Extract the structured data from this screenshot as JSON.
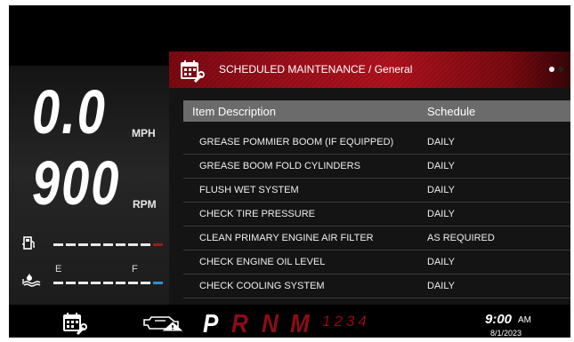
{
  "instrument": {
    "speed": "0.0",
    "speed_unit": "MPH",
    "rpm": "900",
    "rpm_unit": "RPM",
    "fuel_icon": "fuel-pump-icon",
    "temp_icon": "tank-level-icon",
    "empty_label": "E",
    "full_label": "F",
    "fuel_level_fraction": 0.9,
    "tank_level_fraction": 1.0
  },
  "maintenance": {
    "header_icon": "calendar-wrench-icon",
    "title": "SCHEDULED MAINTENANCE / General",
    "page_dots": {
      "total": 2,
      "active": 1
    },
    "columns": {
      "description": "Item Description",
      "schedule": "Schedule"
    },
    "rows": [
      {
        "description": "GREASE POMMIER BOOM (IF EQUIPPED)",
        "schedule": "DAILY"
      },
      {
        "description": "GREASE BOOM FOLD CYLINDERS",
        "schedule": "DAILY"
      },
      {
        "description": "FLUSH WET SYSTEM",
        "schedule": "DAILY"
      },
      {
        "description": "CHECK TIRE PRESSURE",
        "schedule": "DAILY"
      },
      {
        "description": "CLEAN PRIMARY ENGINE AIR FILTER",
        "schedule": "AS REQUIRED"
      },
      {
        "description": "CHECK ENGINE OIL LEVEL",
        "schedule": "DAILY"
      },
      {
        "description": "CHECK COOLING SYSTEM",
        "schedule": "DAILY"
      }
    ]
  },
  "bottom_bar": {
    "schedule_icon": "calendar-wrench-icon",
    "tool_icon": "engine-warning-icon",
    "gears": {
      "p": "P",
      "r": "R",
      "n": "N",
      "m": "M",
      "numbers": "1234"
    },
    "active_gear": "P",
    "time": "9:00",
    "ampm": "AM",
    "date": "8/1/2023"
  },
  "colors": {
    "accent_red": "#b4131f",
    "inactive_gear": "#8c0d17",
    "gauge_blue": "#2c8fd3"
  }
}
